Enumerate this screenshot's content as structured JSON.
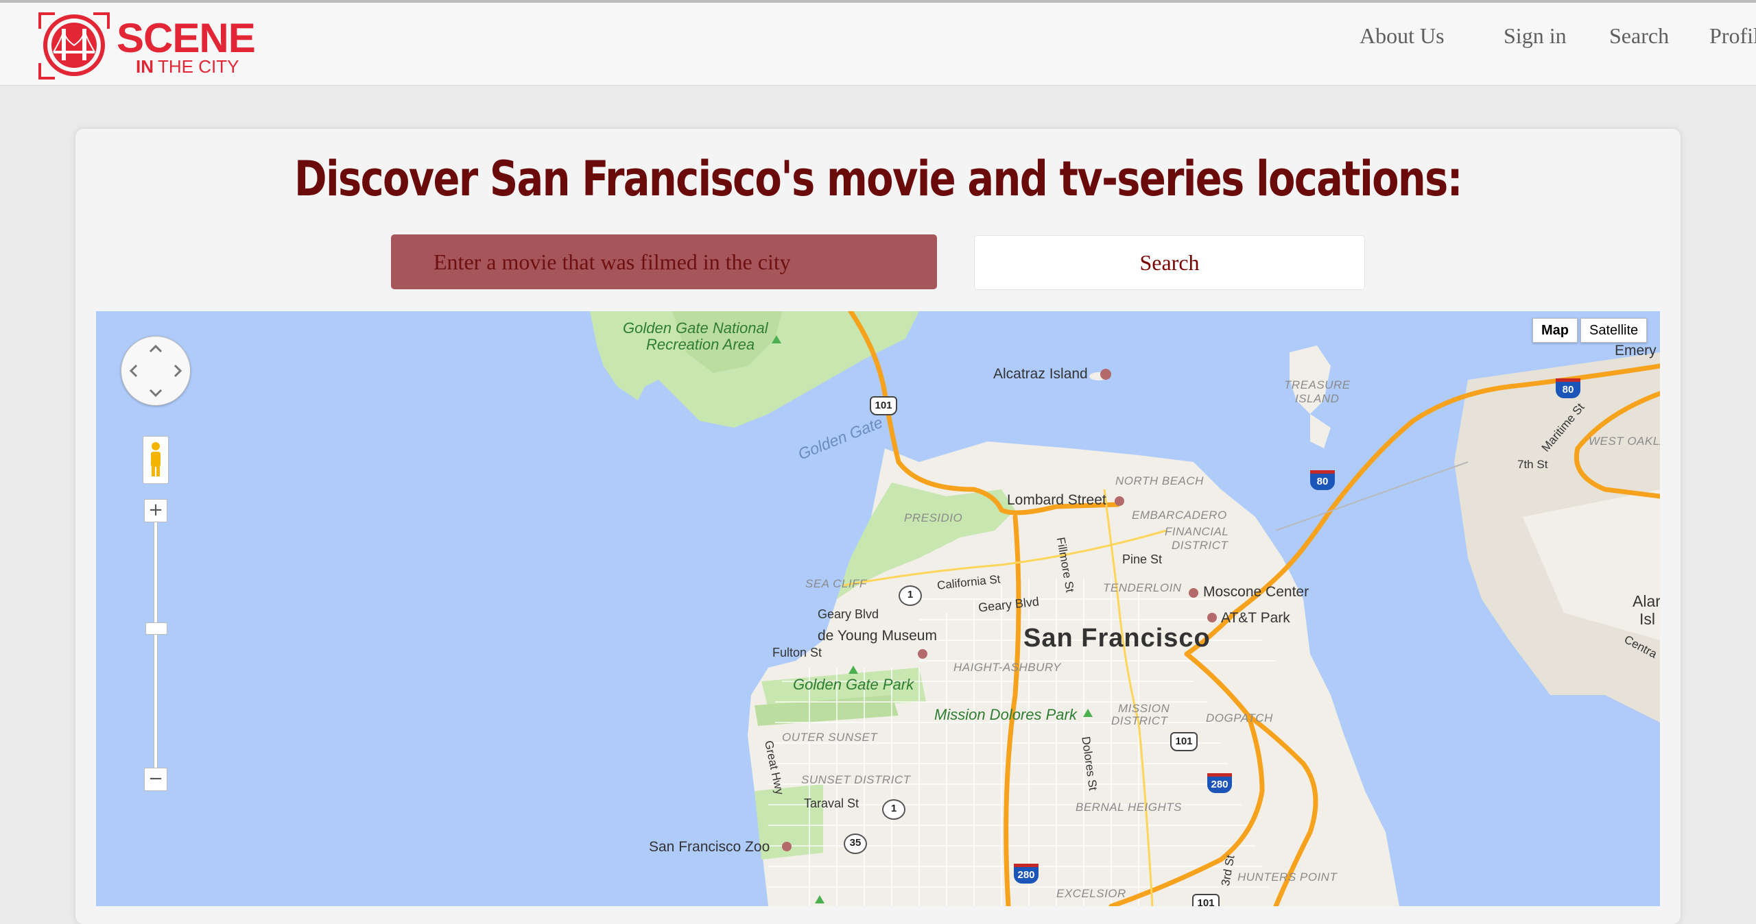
{
  "brand": {
    "name": "SCENE",
    "tagline_bold": "IN",
    "tagline_rest": "THE CITY",
    "color": "#e32636"
  },
  "nav": {
    "items": [
      {
        "label": "About Us"
      },
      {
        "label": "Sign in"
      },
      {
        "label": "Search"
      },
      {
        "label": "Profile"
      }
    ]
  },
  "hero": {
    "headline": "Discover San Francisco's movie and tv-series locations:",
    "search_placeholder": "Enter a movie that was filmed in the city",
    "search_button": "Search",
    "headline_color": "#6b0a0a"
  },
  "map": {
    "type_buttons": [
      "Map",
      "Satellite"
    ],
    "selected_type": "Map",
    "zoom_in": "+",
    "zoom_out": "−",
    "labels": {
      "golden_gate_rec_1": "Golden Gate National",
      "golden_gate_rec_2": "Recreation Area",
      "alcatraz": "Alcatraz Island",
      "treasure_1": "TREASURE",
      "treasure_2": "ISLAND",
      "emery": "Emery",
      "golden_gate": "Golden Gate",
      "west_oakland": "WEST OAKLA",
      "maritime": "Maritime St",
      "seventh": "7th St",
      "north_beach": "NORTH BEACH",
      "lombard": "Lombard Street",
      "embarcadero": "EMBARCADERO",
      "presidio": "PRESIDIO",
      "financial_1": "FINANCIAL",
      "financial_2": "DISTRICT",
      "pine": "Pine St",
      "fillmore": "Fillmore St",
      "sea_cliff": "SEA CLIFF",
      "california": "California St",
      "tenderloin": "TENDERLOIN",
      "moscone": "Moscone Center",
      "att_park": "AT&T Park",
      "geary1": "Geary Blvd",
      "geary2": "Geary Blvd",
      "de_young": "de Young Museum",
      "san_francisco": "San Francisco",
      "fulton": "Fulton St",
      "haight": "HAIGHT-ASHBURY",
      "golden_gate_park": "Golden Gate Park",
      "mission_dolores": "Mission Dolores Park",
      "mission_1": "MISSION",
      "mission_2": "DISTRICT",
      "dogpatch": "DOGPATCH",
      "outer_sunset": "OUTER SUNSET",
      "great_hwy": "Great Hwy",
      "dolores": "Dolores St",
      "sunset": "SUNSET DISTRICT",
      "taraval": "Taraval St",
      "bernal": "BERNAL HEIGHTS",
      "sf_zoo": "San Francisco Zoo",
      "hunters": "HUNTERS POINT",
      "excelsior": "EXCELSIOR",
      "third": "3rd St",
      "alameda_1": "Alar",
      "alameda_2": "Isl",
      "central": "Centra"
    },
    "shields": {
      "us101_a": "101",
      "us101_b": "101",
      "us101_c": "101",
      "i80_a": "80",
      "i80_b": "80",
      "i280_a": "280",
      "i280_b": "280",
      "ca1_a": "1",
      "ca1_b": "1",
      "ca35": "35"
    },
    "water_color": "#aecbfa",
    "land_color": "#f1efe8",
    "park_color": "#c8e6b0",
    "highway_color": "#f6a21d"
  }
}
